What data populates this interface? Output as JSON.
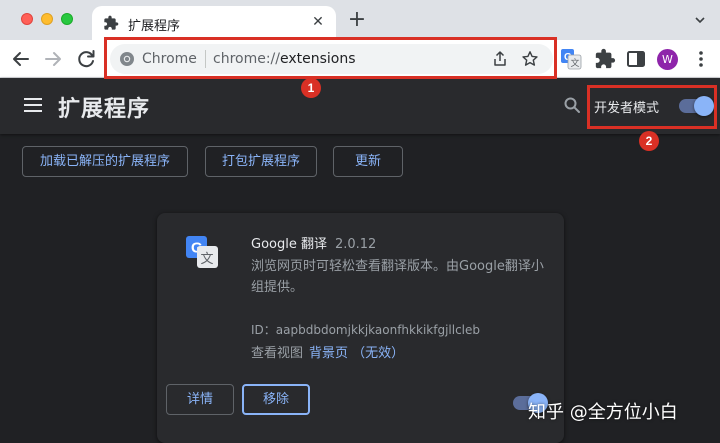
{
  "tab": {
    "title": "扩展程序",
    "close_glyph": "✕",
    "new_tab_glyph": "+"
  },
  "omnibox": {
    "site_label": "Chrome",
    "url_scheme": "chrome://",
    "url_path": "extensions"
  },
  "profile": {
    "initial": "W",
    "color": "#8e24aa"
  },
  "header": {
    "title": "扩展程序",
    "dev_mode_label": "开发者模式",
    "dev_mode_enabled": true
  },
  "actions": {
    "load_unpacked": "加载已解压的扩展程序",
    "pack": "打包扩展程序",
    "update": "更新"
  },
  "extension": {
    "name": "Google 翻译",
    "version": "2.0.12",
    "description": "浏览网页时可轻松查看翻译版本。由Google翻译小组提供。",
    "id_line": "ID：aapbdbdomjkkjkaonfhkkikfgjllcleb",
    "views_label": "查看视图",
    "views_link": "背景页 （无效）",
    "details_button": "详情",
    "remove_button": "移除",
    "enabled": true
  },
  "annotations": {
    "badge_1": "1",
    "badge_2": "2",
    "color": "#d93025"
  },
  "watermark": "知乎 @全方位小白",
  "colors": {
    "accent": "#8ab4f8",
    "background": "#202124",
    "surface": "#292a2d"
  }
}
